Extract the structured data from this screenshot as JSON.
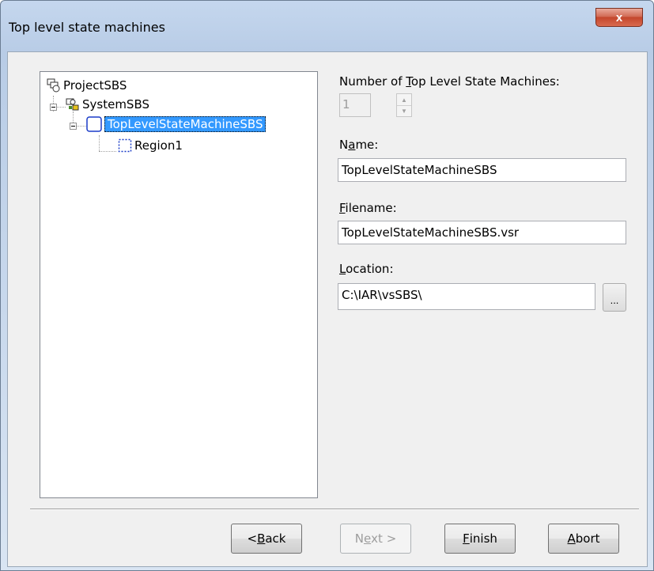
{
  "window": {
    "title": "Top level state machines",
    "close_glyph": "x"
  },
  "tree": {
    "items": [
      {
        "label": "ProjectSBS",
        "icon": "project-icon"
      },
      {
        "label": "SystemSBS",
        "icon": "system-icon"
      },
      {
        "label": "TopLevelStateMachineSBS",
        "icon": "state-machine-icon",
        "selected": true
      },
      {
        "label": "Region1",
        "icon": "region-icon"
      }
    ]
  },
  "form": {
    "count_label_pre": "Number of ",
    "count_label_u": "T",
    "count_label_post": "op Level State Machines:",
    "count_value": "1",
    "name_label_pre": "N",
    "name_label_u": "a",
    "name_label_post": "me:",
    "name_value": "TopLevelStateMachineSBS",
    "filename_label_u": "F",
    "filename_label_post": "ilename:",
    "filename_value": "TopLevelStateMachineSBS.vsr",
    "location_label_u": "L",
    "location_label_post": "ocation:",
    "location_value": "C:\\IAR\\vsSBS\\",
    "browse_label": "..."
  },
  "buttons": {
    "back_pre": "< ",
    "back_u": "B",
    "back_post": "ack",
    "next_pre": "N",
    "next_u": "e",
    "next_post": "xt >",
    "finish_u": "F",
    "finish_post": "inish",
    "abort_u": "A",
    "abort_post": "bort"
  },
  "colors": {
    "selection": "#3399ff",
    "close_button": "#c4462c"
  }
}
